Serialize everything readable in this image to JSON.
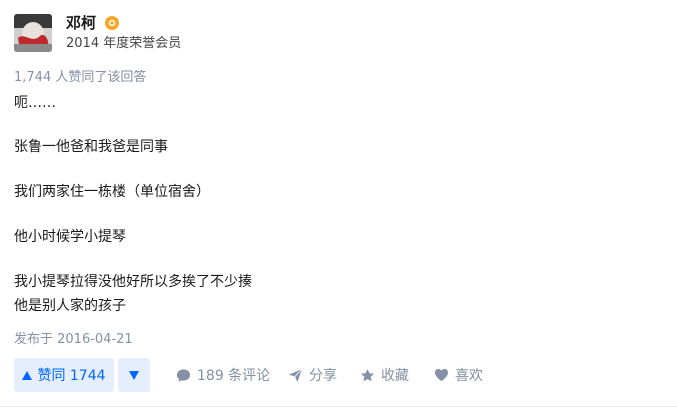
{
  "author": {
    "name": "邓柯",
    "description": "2014 年度荣誉会员"
  },
  "vote_summary": "1,744 人赞同了该回答",
  "content": {
    "paragraphs": [
      [
        "呃……"
      ],
      [
        "张鲁一他爸和我爸是同事"
      ],
      [
        "我们两家住一栋楼（单位宿舍）"
      ],
      [
        "他小时候学小提琴"
      ],
      [
        "我小提琴拉得没他好所以多挨了不少揍",
        "他是别人家的孩子"
      ]
    ]
  },
  "publish_time": "发布于 2016-04-21",
  "actions": {
    "vote_up_label": "赞同 1744",
    "comments_label": "189 条评论",
    "share_label": "分享",
    "collect_label": "收藏",
    "like_label": "喜欢"
  },
  "colors": {
    "accent": "#0066ff",
    "accent_bg": "#e5eefc",
    "muted": "#8590a6",
    "badge": "#f5a623"
  },
  "icons": {
    "avatar": "avatar",
    "badge": "honor-badge-icon",
    "vote_up": "triangle-up-icon",
    "vote_down": "triangle-down-icon",
    "comments": "comment-bubble-icon",
    "share": "paper-plane-icon",
    "collect": "star-icon",
    "like": "heart-icon"
  }
}
